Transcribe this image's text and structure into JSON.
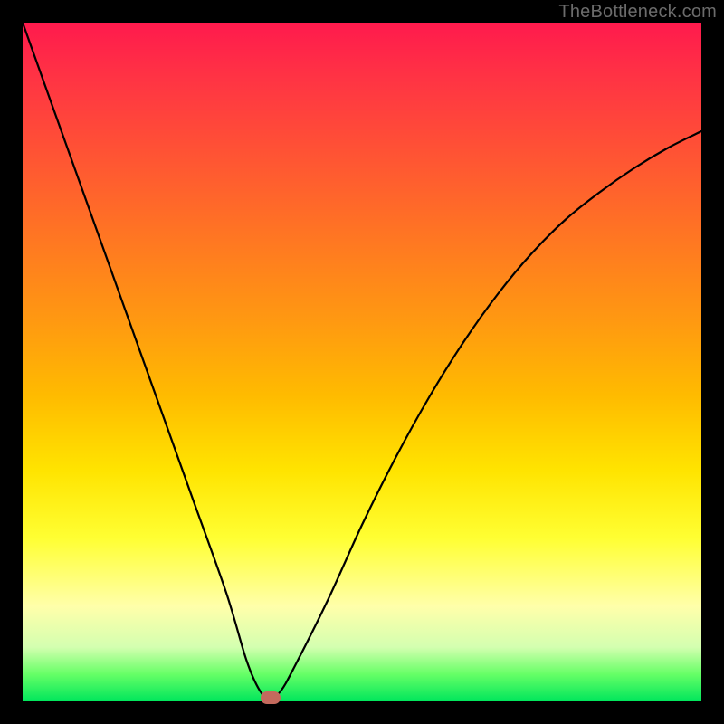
{
  "watermark": "TheBottleneck.com",
  "chart_data": {
    "type": "line",
    "title": "",
    "xlabel": "",
    "ylabel": "",
    "xlim": [
      0,
      100
    ],
    "ylim": [
      0,
      100
    ],
    "grid": false,
    "legend": false,
    "series": [
      {
        "name": "curve",
        "x": [
          0,
          5,
          10,
          15,
          20,
          25,
          30,
          33,
          35,
          36.5,
          38,
          40,
          45,
          50,
          55,
          60,
          65,
          70,
          75,
          80,
          85,
          90,
          95,
          100
        ],
        "y": [
          100,
          86,
          72,
          58,
          44,
          30,
          16,
          6,
          1.5,
          0.5,
          1.5,
          5,
          15,
          26,
          36,
          45,
          53,
          60,
          66,
          71,
          75,
          78.5,
          81.5,
          84
        ]
      }
    ],
    "marker": {
      "x": 36.5,
      "y": 0.6,
      "color": "#c46a5d"
    },
    "background_gradient": {
      "stops": [
        {
          "pos": 0,
          "color": "#ff1a4d"
        },
        {
          "pos": 0.5,
          "color": "#ffbb00"
        },
        {
          "pos": 0.8,
          "color": "#ffff55"
        },
        {
          "pos": 1,
          "color": "#00e65c"
        }
      ]
    }
  }
}
